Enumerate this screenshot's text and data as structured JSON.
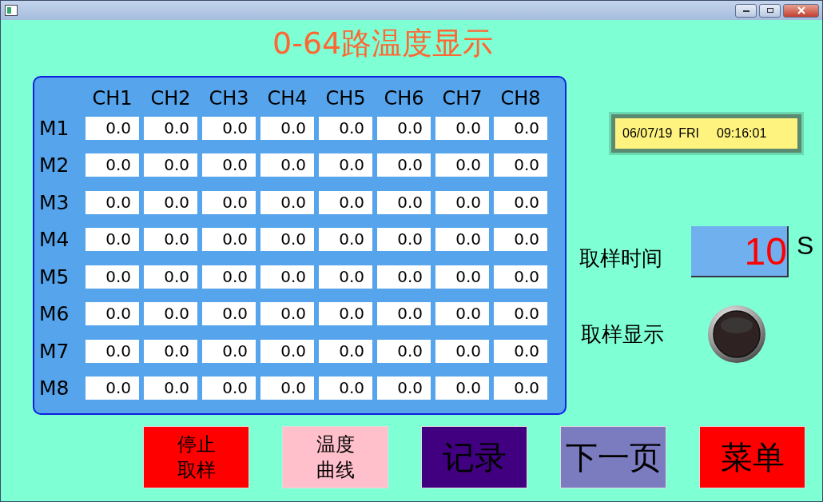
{
  "title": "0-64路温度显示",
  "table": {
    "columns": [
      "CH1",
      "CH2",
      "CH3",
      "CH4",
      "CH5",
      "CH6",
      "CH7",
      "CH8"
    ],
    "rows": [
      {
        "label": "M1",
        "values": [
          "0.0",
          "0.0",
          "0.0",
          "0.0",
          "0.0",
          "0.0",
          "0.0",
          "0.0"
        ]
      },
      {
        "label": "M2",
        "values": [
          "0.0",
          "0.0",
          "0.0",
          "0.0",
          "0.0",
          "0.0",
          "0.0",
          "0.0"
        ]
      },
      {
        "label": "M3",
        "values": [
          "0.0",
          "0.0",
          "0.0",
          "0.0",
          "0.0",
          "0.0",
          "0.0",
          "0.0"
        ]
      },
      {
        "label": "M4",
        "values": [
          "0.0",
          "0.0",
          "0.0",
          "0.0",
          "0.0",
          "0.0",
          "0.0",
          "0.0"
        ]
      },
      {
        "label": "M5",
        "values": [
          "0.0",
          "0.0",
          "0.0",
          "0.0",
          "0.0",
          "0.0",
          "0.0",
          "0.0"
        ]
      },
      {
        "label": "M6",
        "values": [
          "0.0",
          "0.0",
          "0.0",
          "0.0",
          "0.0",
          "0.0",
          "0.0",
          "0.0"
        ]
      },
      {
        "label": "M7",
        "values": [
          "0.0",
          "0.0",
          "0.0",
          "0.0",
          "0.0",
          "0.0",
          "0.0",
          "0.0"
        ]
      },
      {
        "label": "M8",
        "values": [
          "0.0",
          "0.0",
          "0.0",
          "0.0",
          "0.0",
          "0.0",
          "0.0",
          "0.0"
        ]
      }
    ]
  },
  "clock": {
    "date": "06/07/19",
    "day": "FRI",
    "time": "09:16:01"
  },
  "sample_time": {
    "label": "取样时间",
    "value": "10",
    "unit": "S"
  },
  "sample_display": {
    "label": "取样显示",
    "on": false
  },
  "buttons": [
    {
      "lines": [
        "停止",
        "取样"
      ],
      "color": "#ff0000"
    },
    {
      "lines": [
        "温度",
        "曲线"
      ],
      "color": "#ffc0cb"
    },
    {
      "lines": [
        "记录"
      ],
      "color": "#400080"
    },
    {
      "lines": [
        "下一页"
      ],
      "color": "#7b7bc0"
    },
    {
      "lines": [
        "菜单"
      ],
      "color": "#ff0000"
    }
  ]
}
